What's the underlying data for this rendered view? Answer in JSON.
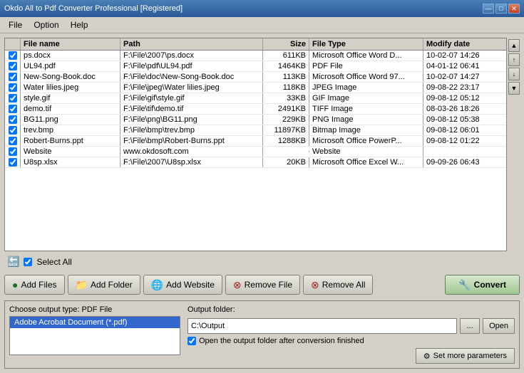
{
  "window": {
    "title": "Okdo All to Pdf Converter Professional [Registered]"
  },
  "titlebar": {
    "minimize": "—",
    "maximize": "□",
    "close": "✕"
  },
  "menu": {
    "items": [
      "File",
      "Option",
      "Help"
    ]
  },
  "filelist": {
    "columns": [
      "File name",
      "Path",
      "Size",
      "File Type",
      "Modify date"
    ],
    "rows": [
      {
        "checked": true,
        "name": "ps.docx",
        "path": "F:\\File\\2007\\ps.docx",
        "size": "611KB",
        "type": "Microsoft Office Word D...",
        "date": "10-02-07 14:26"
      },
      {
        "checked": true,
        "name": "UL94.pdf",
        "path": "F:\\File\\pdf\\UL94.pdf",
        "size": "1464KB",
        "type": "PDF File",
        "date": "04-01-12 06:41"
      },
      {
        "checked": true,
        "name": "New-Song-Book.doc",
        "path": "F:\\File\\doc\\New-Song-Book.doc",
        "size": "113KB",
        "type": "Microsoft Office Word 97...",
        "date": "10-02-07 14:27"
      },
      {
        "checked": true,
        "name": "Water lilies.jpeg",
        "path": "F:\\File\\jpeg\\Water lilies.jpeg",
        "size": "118KB",
        "type": "JPEG Image",
        "date": "09-08-22 23:17"
      },
      {
        "checked": true,
        "name": "style.gif",
        "path": "F:\\File\\gif\\style.gif",
        "size": "33KB",
        "type": "GIF Image",
        "date": "09-08-12 05:12"
      },
      {
        "checked": true,
        "name": "demo.tif",
        "path": "F:\\File\\tif\\demo.tif",
        "size": "2491KB",
        "type": "TIFF Image",
        "date": "08-03-26 18:26"
      },
      {
        "checked": true,
        "name": "BG11.png",
        "path": "F:\\File\\png\\BG11.png",
        "size": "229KB",
        "type": "PNG Image",
        "date": "09-08-12 05:38"
      },
      {
        "checked": true,
        "name": "trev.bmp",
        "path": "F:\\File\\bmp\\trev.bmp",
        "size": "11897KB",
        "type": "Bitmap Image",
        "date": "09-08-12 06:01"
      },
      {
        "checked": true,
        "name": "Robert-Burns.ppt",
        "path": "F:\\File\\bmp\\Robert-Burns.ppt",
        "size": "1288KB",
        "type": "Microsoft Office PowerP...",
        "date": "09-08-12 01:22"
      },
      {
        "checked": true,
        "name": "Website",
        "path": "www.okdosoft.com",
        "size": "",
        "type": "Website",
        "date": ""
      },
      {
        "checked": true,
        "name": "U8sp.xlsx",
        "path": "F:\\File\\2007\\U8sp.xlsx",
        "size": "20KB",
        "type": "Microsoft Office Excel W...",
        "date": "09-09-26 06:43"
      }
    ]
  },
  "toolbar": {
    "select_all_label": "Select All",
    "add_files_label": "Add Files",
    "add_folder_label": "Add Folder",
    "add_website_label": "Add Website",
    "remove_file_label": "Remove File",
    "remove_all_label": "Remove All",
    "convert_label": "Convert"
  },
  "output": {
    "type_label": "Choose output type: PDF File",
    "type_option": "Adobe Acrobat Document (*.pdf)",
    "folder_label": "Output folder:",
    "folder_value": "C:\\Output",
    "browse_btn": "...",
    "open_btn": "Open",
    "open_after_label": "Open the output folder after conversion finished",
    "set_params_label": "Set more parameters"
  }
}
